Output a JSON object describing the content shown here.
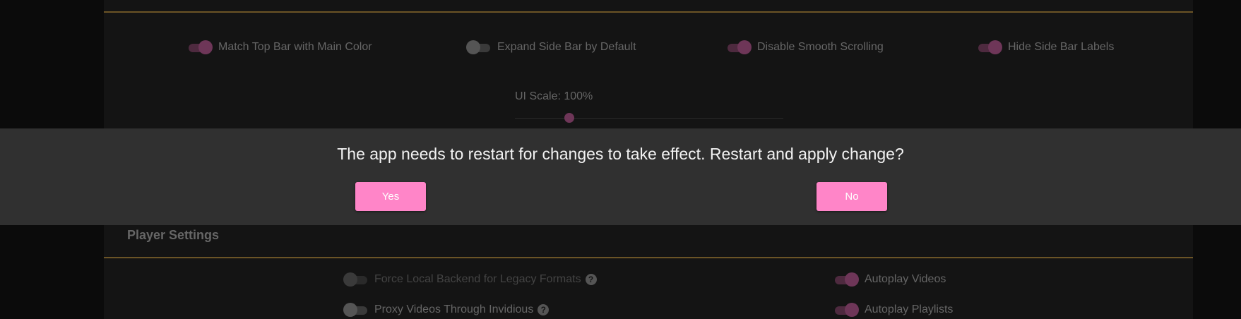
{
  "appearance": {
    "toggles": [
      {
        "label": "Match Top Bar with Main Color",
        "state": "on"
      },
      {
        "label": "Expand Side Bar by Default",
        "state": "off"
      },
      {
        "label": "Disable Smooth Scrolling",
        "state": "on"
      },
      {
        "label": "Hide Side Bar Labels",
        "state": "on"
      }
    ],
    "ui_scale": {
      "label": "UI Scale: 100%",
      "value_percent": 100
    }
  },
  "player_settings": {
    "title": "Player Settings",
    "left_toggles": [
      {
        "label": "Force Local Backend for Legacy Formats",
        "state": "off",
        "disabled": true,
        "help": true
      },
      {
        "label": "Proxy Videos Through Invidious",
        "state": "off",
        "disabled": false,
        "help": true
      }
    ],
    "right_toggles": [
      {
        "label": "Autoplay Videos",
        "state": "on"
      },
      {
        "label": "Autoplay Playlists",
        "state": "on"
      }
    ]
  },
  "dialog": {
    "message": "The app needs to restart for changes to take effect. Restart and apply change?",
    "yes_label": "Yes",
    "no_label": "No"
  },
  "icons": {
    "help": "question-circle-icon"
  },
  "colors": {
    "accent": "#ff85c8",
    "section_rule": "#6b5426",
    "toggle_on": "#6e3658"
  }
}
